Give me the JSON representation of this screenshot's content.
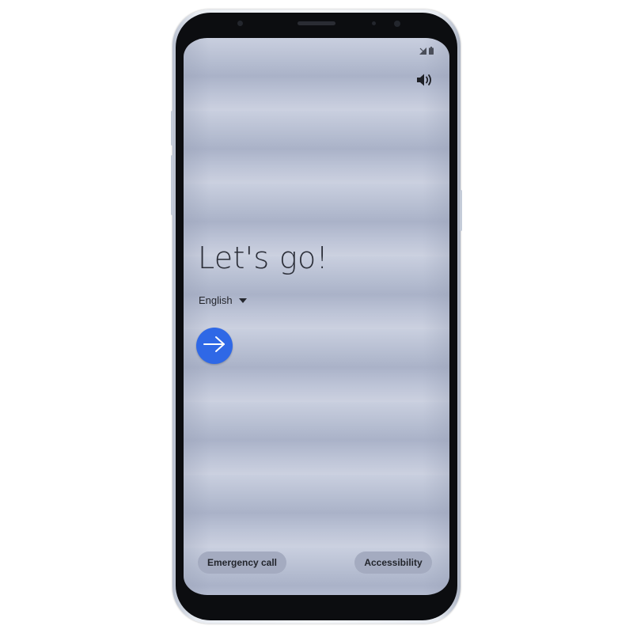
{
  "status_bar": {
    "icons": [
      "signal-no-sim-icon",
      "battery-icon"
    ]
  },
  "volume": {
    "icon": "volume-icon"
  },
  "welcome": {
    "title": "Let's go!",
    "language": "English"
  },
  "next_button": {
    "icon": "arrow-right-icon",
    "color": "#2f68e6"
  },
  "footer": {
    "emergency_label": "Emergency call",
    "accessibility_label": "Accessibility"
  }
}
